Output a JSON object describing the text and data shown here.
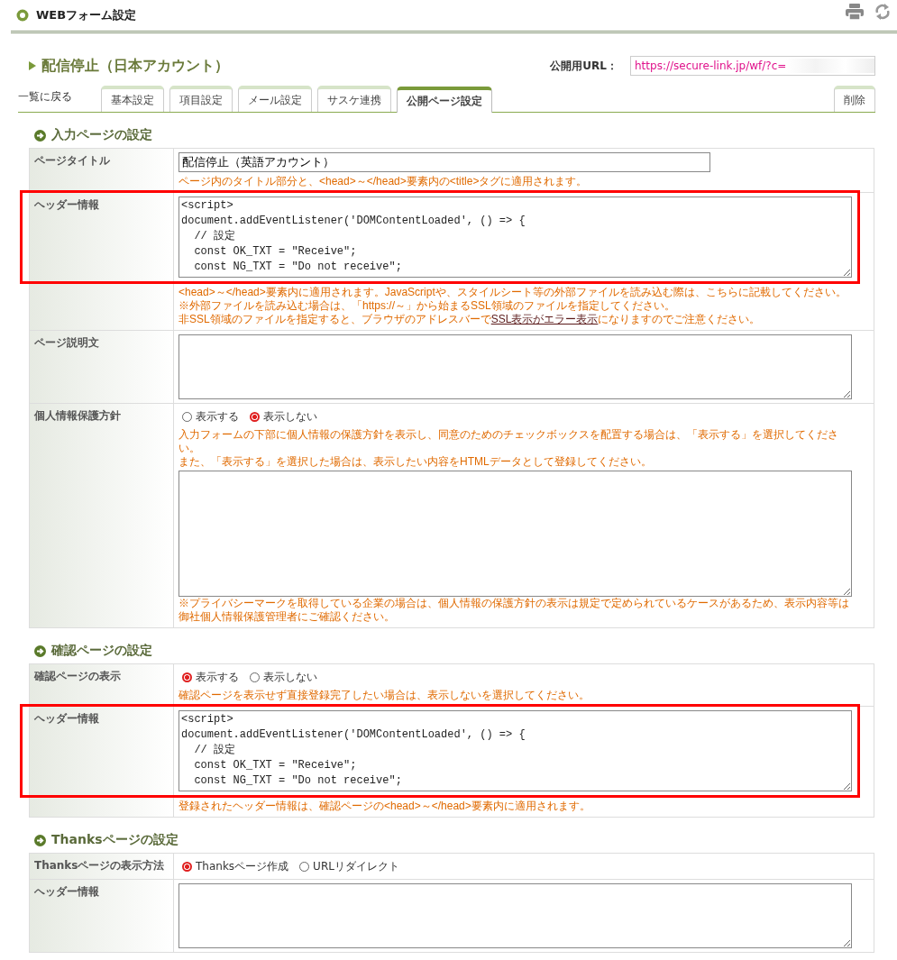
{
  "header": {
    "title": "WEBフォーム設定"
  },
  "page": {
    "title": "配信停止（日本アカウント）",
    "url_label": "公開用URL：",
    "url_value": "https://secure-link.jp/wf/?c="
  },
  "nav": {
    "back_link": "一覧に戻る",
    "tabs": [
      {
        "label": "基本設定",
        "selected": false
      },
      {
        "label": "項目設定",
        "selected": false
      },
      {
        "label": "メール設定",
        "selected": false
      },
      {
        "label": "サスケ連携",
        "selected": false
      },
      {
        "label": "公開ページ設定",
        "selected": true
      }
    ],
    "delete_tab": "削除"
  },
  "sections": [
    {
      "title": "入力ページの設定",
      "rows": [
        {
          "label": "ページタイトル",
          "kind": "input",
          "value": "配信停止（英語アカウント）",
          "highlighted": false,
          "hints": [
            {
              "text": "ページ内のタイトル部分と、<head>～</head>要素内の<title>タグに適用されます。"
            }
          ]
        },
        {
          "label": "ヘッダー情報",
          "kind": "code",
          "highlighted": true,
          "lines": [
            "<script>",
            "document.addEventListener('DOMContentLoaded', () => {",
            "  // 設定",
            "  const OK_TXT = \"Receive\";",
            "  const NG_TXT = \"Do not receive\";"
          ],
          "hints": [
            {
              "text": "<head>～</head>要素内に適用されます。JavaScriptや、スタイルシート等の外部ファイルを読み込む際は、こちらに記載してください。"
            },
            {
              "text": "※外部ファイルを読み込む場合は、「https://～」から始まるSSL領域のファイルを指定してください。"
            },
            {
              "text": "非SSL領域のファイルを指定すると、ブラウザのアドレスバーで",
              "link": "SSL表示がエラー表示",
              "after": "になりますのでご注意ください。"
            }
          ]
        },
        {
          "label": "ページ説明文",
          "kind": "textarea",
          "highlighted": false
        },
        {
          "label": "個人情報保護方針",
          "kind": "radio",
          "highlighted": false,
          "options": [
            {
              "label": "表示する",
              "selected": false
            },
            {
              "label": "表示しない",
              "selected": true
            }
          ],
          "hints": [
            {
              "text": "入力フォームの下部に個人情報の保護方針を表示し、同意のためのチェックボックスを配置する場合は、「表示する」を選択してください。"
            },
            {
              "text": "また、「表示する」を選択した場合は、表示したい内容をHTMLデータとして登録してください。"
            }
          ],
          "textarea": true,
          "footnote": "※プライバシーマークを取得している企業の場合は、個人情報の保護方針の表示は規定で定められているケースがあるため、表示内容等は御社個人情報保護管理者にご確認ください。"
        }
      ]
    },
    {
      "title": "確認ページの設定",
      "rows": [
        {
          "label": "確認ページの表示",
          "kind": "radio",
          "highlighted": false,
          "options": [
            {
              "label": "表示する",
              "selected": true
            },
            {
              "label": "表示しない",
              "selected": false
            }
          ],
          "hints": [
            {
              "text": "確認ページを表示せず直接登録完了したい場合は、表示しないを選択してください。"
            }
          ]
        },
        {
          "label": "ヘッダー情報",
          "kind": "code",
          "highlighted": true,
          "lines": [
            "<script>",
            "document.addEventListener('DOMContentLoaded', () => {",
            "  // 設定",
            "  const OK_TXT = \"Receive\";",
            "  const NG_TXT = \"Do not receive\";"
          ],
          "hints": [
            {
              "text": "登録されたヘッダー情報は、確認ページの<head>～</head>要素内に適用されます。"
            }
          ]
        }
      ]
    },
    {
      "title": "Thanksページの設定",
      "rows": [
        {
          "label": "Thanksページの表示方法",
          "kind": "radio",
          "highlighted": false,
          "options": [
            {
              "label": "Thanksページ作成",
              "selected": true
            },
            {
              "label": "URLリダイレクト",
              "selected": false
            }
          ]
        },
        {
          "label": "ヘッダー情報",
          "kind": "textarea",
          "highlighted": false
        }
      ]
    }
  ]
}
